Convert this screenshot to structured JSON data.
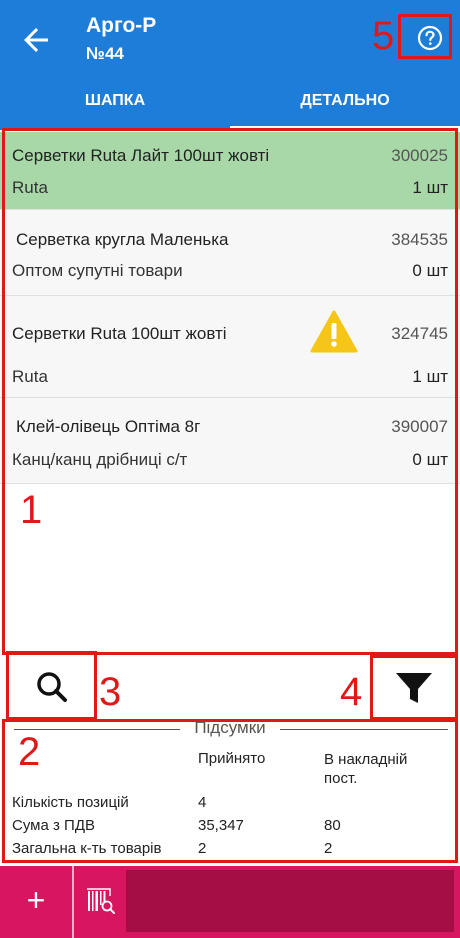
{
  "header": {
    "title": "Арго-Р",
    "subtitle": "№44",
    "back_icon": "arrow-left-icon",
    "help_icon": "question-circle-icon"
  },
  "tabs": [
    {
      "label": "ШАПКА",
      "active": false
    },
    {
      "label": "ДЕТАЛЬНО",
      "active": true
    }
  ],
  "items": [
    {
      "name": "Серветки Ruta Лайт 100шт жовті",
      "code": "300025",
      "category": "Ruta",
      "qty": "1 шт",
      "highlighted": true,
      "warning": false
    },
    {
      "name": "Серветка кругла Маленька",
      "code": "384535",
      "category": "Оптом супутні товари",
      "qty": "0 шт",
      "highlighted": false,
      "warning": false
    },
    {
      "name": "Серветки Ruta 100шт жовті",
      "code": "324745",
      "category": "Ruta",
      "qty": "1 шт",
      "highlighted": false,
      "warning": true
    },
    {
      "name": "Клей-олівець Оптіма 8г",
      "code": "390007",
      "category": "Канц/канц дрібниці с/т",
      "qty": "0 шт",
      "highlighted": false,
      "warning": false
    }
  ],
  "summary": {
    "title": "Підсумки",
    "col_accepted": "Прийнято",
    "col_invoice": "В накладній пост.",
    "rows": [
      {
        "label": "Кількість позицій",
        "accepted": "4",
        "invoice": ""
      },
      {
        "label": "Сума з ПДВ",
        "accepted": "35,347",
        "invoice": "80"
      },
      {
        "label": "Загальна к-ть товарів",
        "accepted": "2",
        "invoice": "2"
      }
    ]
  },
  "annotations": [
    "1",
    "2",
    "3",
    "4",
    "5"
  ],
  "bottom": {
    "add_label": "+",
    "scan_icon": "barcode-scan-icon"
  },
  "colors": {
    "appbar": "#1e7dd8",
    "highlight_row": "#a8d8a8",
    "warning": "#f5c518",
    "bottom_bar": "#d8155f",
    "annotation": "#e01818"
  }
}
